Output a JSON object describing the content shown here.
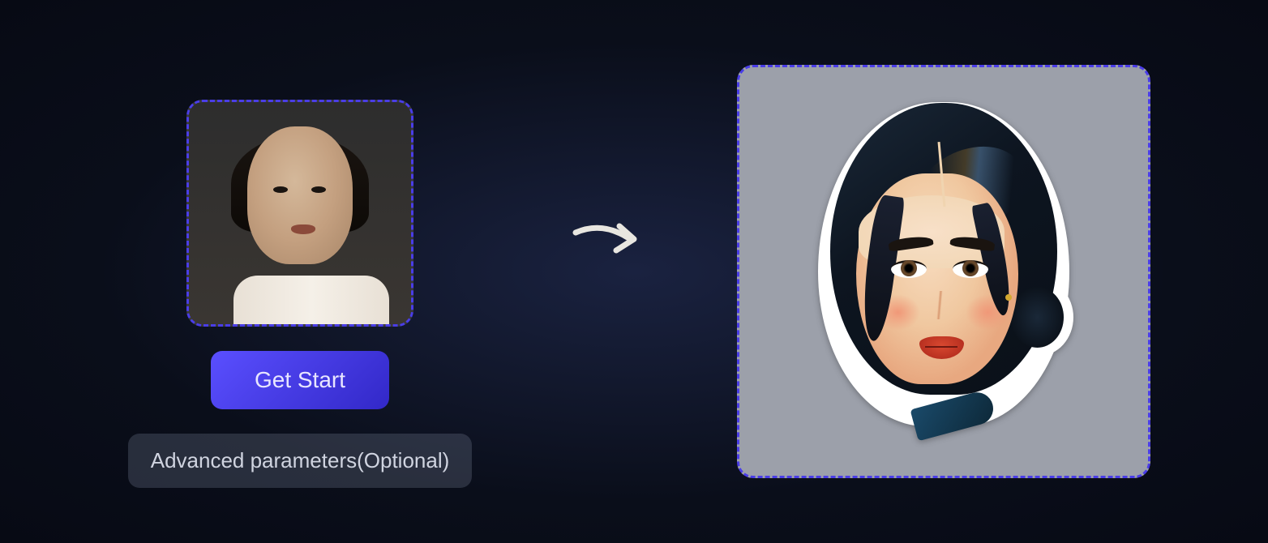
{
  "buttons": {
    "get_start": "Get Start",
    "advanced_params": "Advanced parameters(Optional)"
  },
  "panels": {
    "input_alt": "input-portrait-photo",
    "output_alt": "output-sticker-art"
  },
  "colors": {
    "accent_border": "#4a3de8",
    "button_primary_start": "#5a4fff",
    "button_primary_end": "#3228c8"
  }
}
